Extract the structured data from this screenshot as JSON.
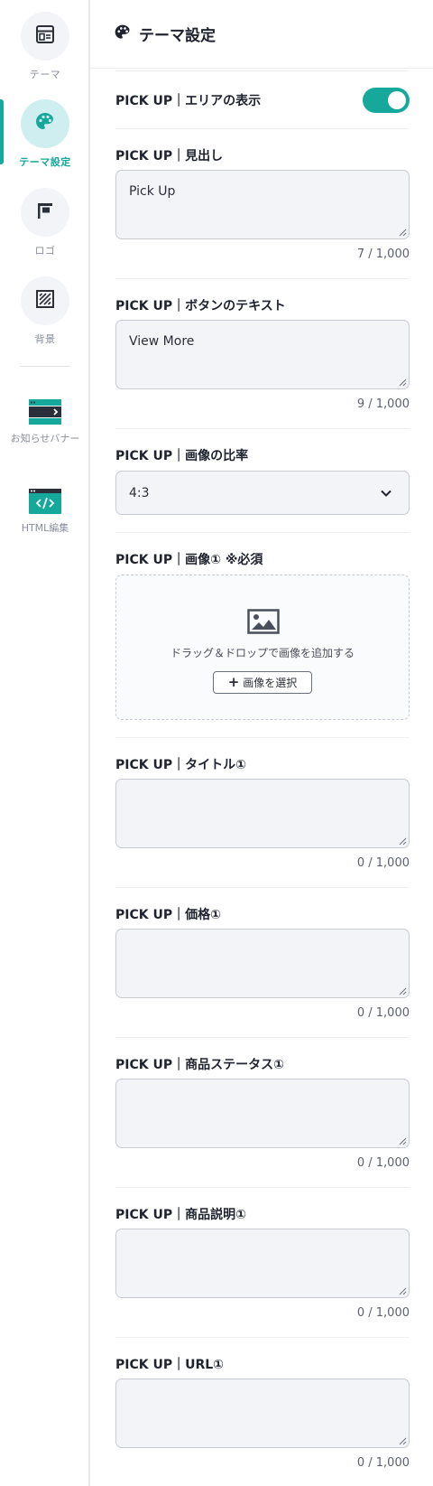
{
  "sidebar": {
    "items": [
      {
        "label": "テーマ",
        "icon": "layout-icon"
      },
      {
        "label": "テーマ設定",
        "icon": "palette-icon",
        "active": true
      },
      {
        "label": "ロゴ",
        "icon": "flag-icon"
      },
      {
        "label": "背景",
        "icon": "hatch-pattern-icon"
      },
      {
        "label": "お知らせバナー",
        "icon": "banner-icon"
      },
      {
        "label": "HTML編集",
        "icon": "code-icon"
      }
    ]
  },
  "header": {
    "title": "テーマ設定",
    "icon": "palette-icon"
  },
  "colors": {
    "accent": "#16a89b",
    "input_bg": "#f3f4f7",
    "border": "#c8cbd3"
  },
  "fields": {
    "area_display": {
      "label": "PICK UP｜エリアの表示",
      "toggle_on": true
    },
    "heading": {
      "label": "PICK UP｜見出し",
      "value": "Pick Up",
      "counter": "7 / 1,000"
    },
    "button_text": {
      "label": "PICK UP｜ボタンのテキスト",
      "value": "View More",
      "counter": "9 / 1,000"
    },
    "image_ratio": {
      "label": "PICK UP｜画像の比率",
      "value": "4:3"
    },
    "image1": {
      "label": "PICK UP｜画像① ※必須",
      "drop_text": "ドラッグ＆ドロップで画像を追加する",
      "button_label": "画像を選択"
    },
    "title1": {
      "label": "PICK UP｜タイトル①",
      "value": "",
      "counter": "0 / 1,000"
    },
    "price1": {
      "label": "PICK UP｜価格①",
      "value": "",
      "counter": "0 / 1,000"
    },
    "status1": {
      "label": "PICK UP｜商品ステータス①",
      "value": "",
      "counter": "0 / 1,000"
    },
    "description1": {
      "label": "PICK UP｜商品説明①",
      "value": "",
      "counter": "0 / 1,000"
    },
    "url1": {
      "label": "PICK UP｜URL①",
      "value": "",
      "counter": "0 / 1,000"
    }
  }
}
